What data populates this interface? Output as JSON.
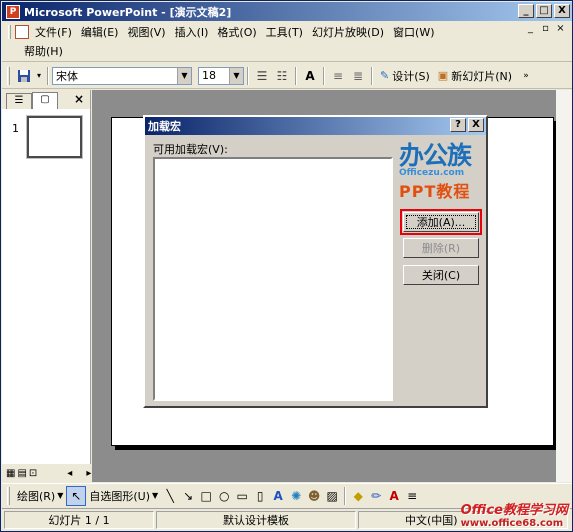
{
  "window": {
    "title": "Microsoft PowerPoint - [演示文稿2]",
    "minimize": "_",
    "restore": "□",
    "close": "X"
  },
  "menu": {
    "items": [
      "文件(F)",
      "编辑(E)",
      "视图(V)",
      "插入(I)",
      "格式(O)",
      "工具(T)",
      "幻灯片放映(D)",
      "窗口(W)"
    ],
    "help": "帮助(H)"
  },
  "toolbar": {
    "font_name": "宋体",
    "font_size": "18",
    "design_label": "设计(S)",
    "new_slide_label": "新幻灯片(N)"
  },
  "left_pane": {
    "slide_number": "1"
  },
  "dialog": {
    "title": "加载宏",
    "help_btn": "?",
    "close_btn": "X",
    "list_label": "可用加载宏(V):",
    "add_button": "添加(A)...",
    "remove_button": "删除(R)",
    "close_button": "关闭(C)"
  },
  "drawing_toolbar": {
    "draw_label": "绘图(R)",
    "autoshapes_label": "自选图形(U)"
  },
  "status": {
    "slide_info": "幻灯片 1 / 1",
    "template": "默认设计模板",
    "language": "中文(中国)"
  },
  "watermark": {
    "logo_text": "办公族",
    "logo_url": "Officezu.com",
    "logo_sub": "PPT教程",
    "bottom_text": "Office教程学习网",
    "bottom_url": "www.office68.com"
  },
  "colors": {
    "title_bar": "#0a246a",
    "highlight": "#e8000a",
    "workspace": "#8c8c8c"
  }
}
